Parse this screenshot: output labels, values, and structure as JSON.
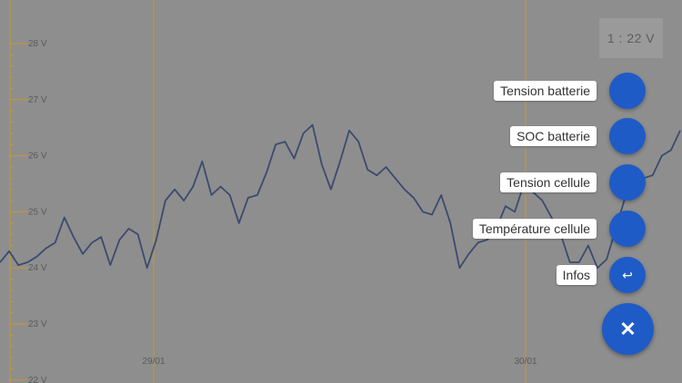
{
  "chart_data": {
    "type": "line",
    "y_ticks": [
      "28 V",
      "27 V",
      "26 V",
      "25 V",
      "24 V",
      "23 V",
      "22 V"
    ],
    "y_tick_values": [
      28,
      27,
      26,
      25,
      24,
      23,
      22
    ],
    "ylim": [
      22,
      28.6
    ],
    "x_ticks": [
      "29/01",
      "30/01"
    ],
    "series": [
      {
        "color": "#3b4a70",
        "points_description": "sampled voltage readings",
        "values": [
          24.1,
          24.3,
          24.05,
          24.1,
          24.2,
          24.35,
          24.45,
          24.9,
          24.55,
          24.25,
          24.45,
          24.55,
          24.05,
          24.5,
          24.7,
          24.6,
          24.0,
          24.5,
          25.2,
          25.4,
          25.2,
          25.45,
          25.9,
          25.3,
          25.45,
          25.3,
          24.8,
          25.25,
          25.3,
          25.7,
          26.2,
          26.25,
          25.95,
          26.4,
          26.55,
          25.85,
          25.4,
          25.9,
          26.45,
          26.25,
          25.75,
          25.65,
          25.8,
          25.6,
          25.4,
          25.25,
          25.0,
          24.95,
          25.3,
          24.8,
          24.0,
          24.25,
          24.45,
          24.5,
          24.7,
          25.1,
          25.0,
          25.5,
          25.35,
          25.2,
          24.9,
          24.6,
          24.1,
          24.1,
          24.4,
          24.0,
          24.15,
          24.7,
          25.25,
          25.5,
          25.6,
          25.65,
          26.0,
          26.1,
          26.45
        ]
      }
    ]
  },
  "readout": {
    "value": "1 : 22  V"
  },
  "menu": {
    "items": [
      {
        "label": "Tension batterie",
        "icon": ""
      },
      {
        "label": "SOC batterie",
        "icon": ""
      },
      {
        "label": "Tension cellule",
        "icon": ""
      },
      {
        "label": "Température cellule",
        "icon": ""
      },
      {
        "label": "Infos",
        "icon": "↩"
      }
    ],
    "close_icon": "✕"
  },
  "colors": {
    "background": "#8e8e8e",
    "fab": "#1f5bc7",
    "line": "#3b4a70",
    "axis": "#c79a2a"
  }
}
